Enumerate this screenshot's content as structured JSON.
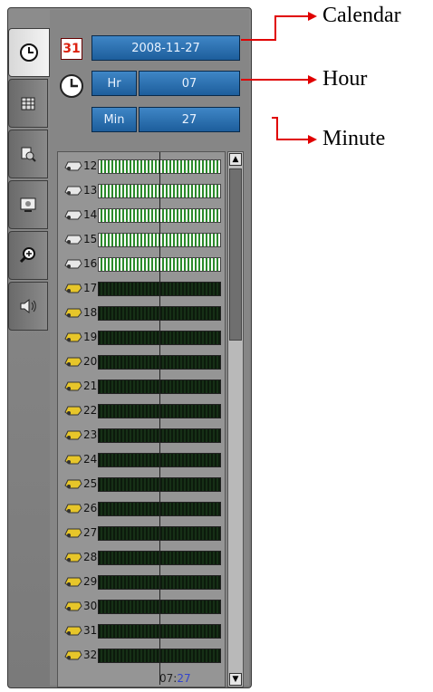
{
  "date": "2008-11-27",
  "calendar_icon_text": "31",
  "hour": {
    "label": "Hr",
    "value": "07"
  },
  "minute": {
    "label": "Min",
    "value": "27"
  },
  "timeline": {
    "time_hour": "07",
    "time_sep": ":",
    "time_min": "27"
  },
  "channels": [
    {
      "num": "12",
      "state": "recording"
    },
    {
      "num": "13",
      "state": "recording"
    },
    {
      "num": "14",
      "state": "recording"
    },
    {
      "num": "15",
      "state": "recording"
    },
    {
      "num": "16",
      "state": "recording"
    },
    {
      "num": "17",
      "state": "idle"
    },
    {
      "num": "18",
      "state": "idle"
    },
    {
      "num": "19",
      "state": "idle"
    },
    {
      "num": "20",
      "state": "idle"
    },
    {
      "num": "21",
      "state": "idle"
    },
    {
      "num": "22",
      "state": "idle"
    },
    {
      "num": "23",
      "state": "idle"
    },
    {
      "num": "24",
      "state": "idle"
    },
    {
      "num": "25",
      "state": "idle"
    },
    {
      "num": "26",
      "state": "idle"
    },
    {
      "num": "27",
      "state": "idle"
    },
    {
      "num": "28",
      "state": "idle"
    },
    {
      "num": "29",
      "state": "idle"
    },
    {
      "num": "30",
      "state": "idle"
    },
    {
      "num": "31",
      "state": "idle"
    },
    {
      "num": "32",
      "state": "idle"
    }
  ],
  "tabs": [
    "clock-icon",
    "grid-icon",
    "camera-search-icon",
    "monitor-icon",
    "zoom-icon",
    "speaker-icon"
  ],
  "annotations": {
    "calendar": "Calendar",
    "hour": "Hour",
    "minute": "Minute"
  },
  "colors": {
    "accent_blue": "#2a6fb0",
    "recording_green": "#2a8a2a",
    "idle_green": "#163016",
    "callout_red": "#e00000"
  }
}
